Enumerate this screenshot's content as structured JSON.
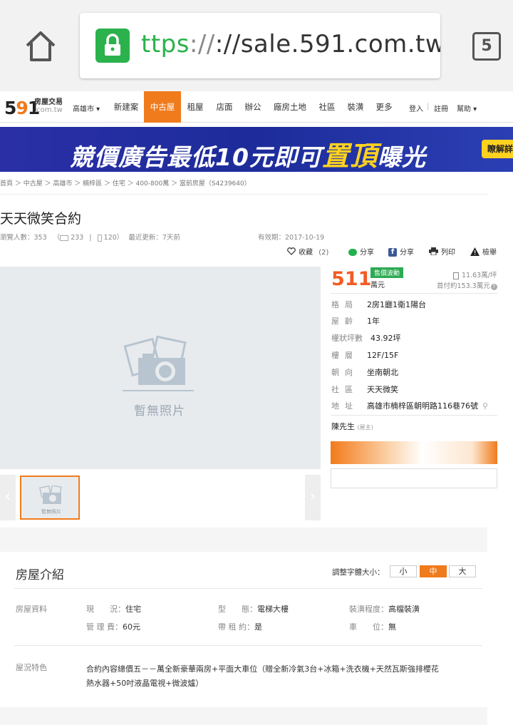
{
  "browser": {
    "url_scheme_visible": "ttps",
    "url_rest": "://sale.591.com.tw/",
    "url_cut": "l",
    "tab_count": "5",
    "accent_green": "#2bb24c"
  },
  "site": {
    "logo_num_a": "5",
    "logo_num_b": "9",
    "logo_num_c": "1",
    "logo_cn": "房屋交易",
    "logo_domain": ".com.tw",
    "city": "高雄市 ▾",
    "nav": [
      {
        "label": "新建案"
      },
      {
        "label": "中古屋"
      },
      {
        "label": "租屋"
      },
      {
        "label": "店面"
      },
      {
        "label": "辦公"
      },
      {
        "label": "廠房土地"
      },
      {
        "label": "社區"
      },
      {
        "label": "裝潢"
      },
      {
        "label": "更多"
      }
    ],
    "login": "登入",
    "login_sep": "|",
    "register": "註冊",
    "help": "幫助 ▾",
    "accent": "#f07b1c"
  },
  "banner": {
    "text_a": "競價廣告最低",
    "text_b": "10元即可",
    "text_big": "置頂",
    "text_c": "曝光",
    "tag": "瞭解詳"
  },
  "breadcrumb": "首頁 ＞ 中古屋 ＞ 高雄市 ＞ 楠梓區 ＞ 住宅 ＞ 400-800萬 ＞ 當前房屋（S4239640）",
  "listing": {
    "title": "天天微笑合約",
    "views_label": "瀏覽人數：353",
    "pc_views": "233",
    "mobile_views": "120）",
    "updated": "最近更新：7天前",
    "valid": "有效期：2017-10-19",
    "actions": {
      "fav": "收藏",
      "fav_count": "(2)",
      "share_line": "分享",
      "share_fb": "分享",
      "print": "列印",
      "report": "檢舉"
    }
  },
  "photo": {
    "no_photo": "暫無照片",
    "thumb_label": "暫無照片"
  },
  "price": {
    "value": "511",
    "unit": "萬元",
    "tag": "售價波動",
    "unit_price": "11.63萬/坪",
    "down_payment": "首付約153.3萬元",
    "color": "#f25c24"
  },
  "info": [
    {
      "label": "格局",
      "value": "2房1廳1衛1陽台"
    },
    {
      "label": "屋齡",
      "value": "1年"
    },
    {
      "label": "權狀坪數",
      "value": "43.92坪"
    },
    {
      "label": "樓層",
      "value": "12F/15F"
    },
    {
      "label": "朝向",
      "value": "坐南朝北"
    },
    {
      "label": "社區",
      "value": "天天微笑"
    },
    {
      "label": "地址",
      "value": "高雄市楠梓區朝明路116巷76號"
    }
  ],
  "owner": {
    "name": "陳先生",
    "role": "(屋主)"
  },
  "intro": {
    "title": "房屋介紹",
    "font_adjust_label": "調整字體大小：",
    "font_small": "小",
    "font_mid": "中",
    "font_large": "大",
    "data_label": "房屋資料",
    "details": [
      {
        "key": "現　　況：",
        "value": "住宅"
      },
      {
        "key": "型　　態：",
        "value": "電梯大樓"
      },
      {
        "key": "裝潢程度：",
        "value": "高檔裝潢"
      },
      {
        "key": "管 理 費：",
        "value": "60元"
      },
      {
        "key": "帶 租 約：",
        "value": "是"
      },
      {
        "key": "車　　位：",
        "value": "無"
      }
    ],
    "feature_label": "屋況特色",
    "feature_text": "合約內容總價五－－萬全新豪華兩房+平面大車位（贈全新冷氣3台+冰箱+洗衣機+天然瓦斯強排櫻花熱水器+50吋液晶電視+微波爐）"
  }
}
